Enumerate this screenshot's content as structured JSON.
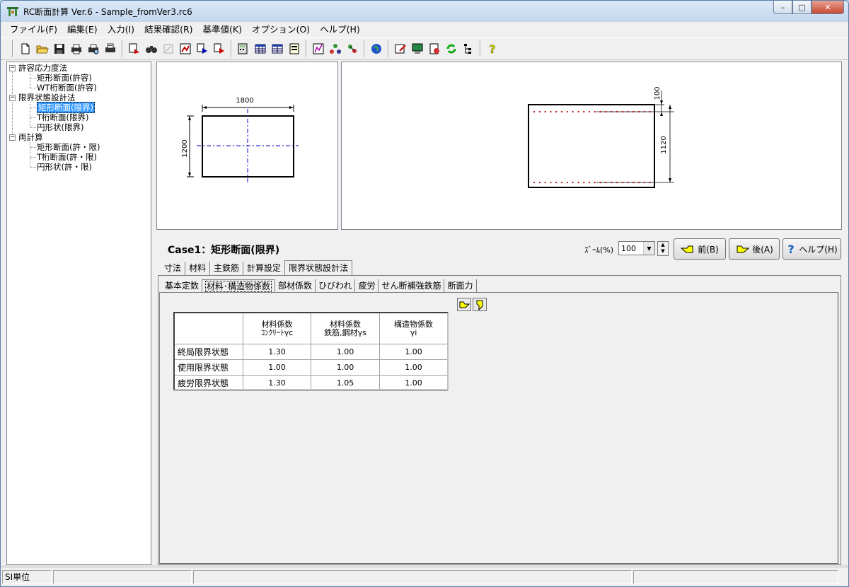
{
  "window": {
    "title": "RC断面計算 Ver.6 - Sample_fromVer3.rc6",
    "minimize": "–",
    "maximize": "□",
    "close": "✕"
  },
  "menu": [
    "ファイル(F)",
    "編集(E)",
    "入力(I)",
    "結果確認(R)",
    "基準値(K)",
    "オプション(O)",
    "ヘルプ(H)"
  ],
  "tree": {
    "groups": [
      {
        "label": "許容応力度法",
        "items": [
          "矩形断面(許容)",
          "WT桁断面(許容)"
        ]
      },
      {
        "label": "限界状態設計法",
        "items": [
          "矩形断面(限界)",
          "T桁断面(限界)",
          "円形状(限界)"
        ]
      },
      {
        "label": "両計算",
        "items": [
          "矩形断面(許・限)",
          "T桁断面(許・限)",
          "円形状(許・限)"
        ]
      }
    ],
    "selected": "矩形断面(限界)"
  },
  "preview_left": {
    "width_dim": "1800",
    "height_dim": "1200"
  },
  "preview_right": {
    "top_dim": "100",
    "height_dim": "1120"
  },
  "case_title": "Case1：矩形断面(限界)",
  "zoom": {
    "label": "ｽﾞｰﾑ(%)",
    "value": "100"
  },
  "nav": {
    "prev": "前(B)",
    "prev_key": "B",
    "next": "後(A)",
    "next_key": "A",
    "help": "ヘルプ(H)",
    "help_key": "H"
  },
  "tabs": [
    "寸法",
    "材料",
    "主鉄筋",
    "計算設定",
    "限界状態設計法"
  ],
  "active_tab": "限界状態設計法",
  "subtabs": [
    "基本定数",
    "材料･構造物係数",
    "部材係数",
    "ひびわれ",
    "疲労",
    "せん断補強鉄筋",
    "断面力"
  ],
  "active_subtab": "材料･構造物係数",
  "table": {
    "headers": [
      {
        "line1": "材料係数",
        "line2": "ｺﾝｸﾘｰﾄγc"
      },
      {
        "line1": "材料係数",
        "line2": "鉄筋,鋼材γs"
      },
      {
        "line1": "構造物係数",
        "line2": "γi"
      }
    ],
    "rows": [
      {
        "label": "終局限界状態",
        "values": [
          "1.30",
          "1.00",
          "1.00"
        ]
      },
      {
        "label": "使用限界状態",
        "values": [
          "1.00",
          "1.00",
          "1.00"
        ]
      },
      {
        "label": "疲労限界状態",
        "values": [
          "1.30",
          "1.05",
          "1.00"
        ]
      }
    ]
  },
  "status": {
    "unit": "SI単位"
  },
  "colors": {
    "selection": "#3399ff",
    "rebar": "#c00000",
    "centerline": "#0000cc"
  }
}
